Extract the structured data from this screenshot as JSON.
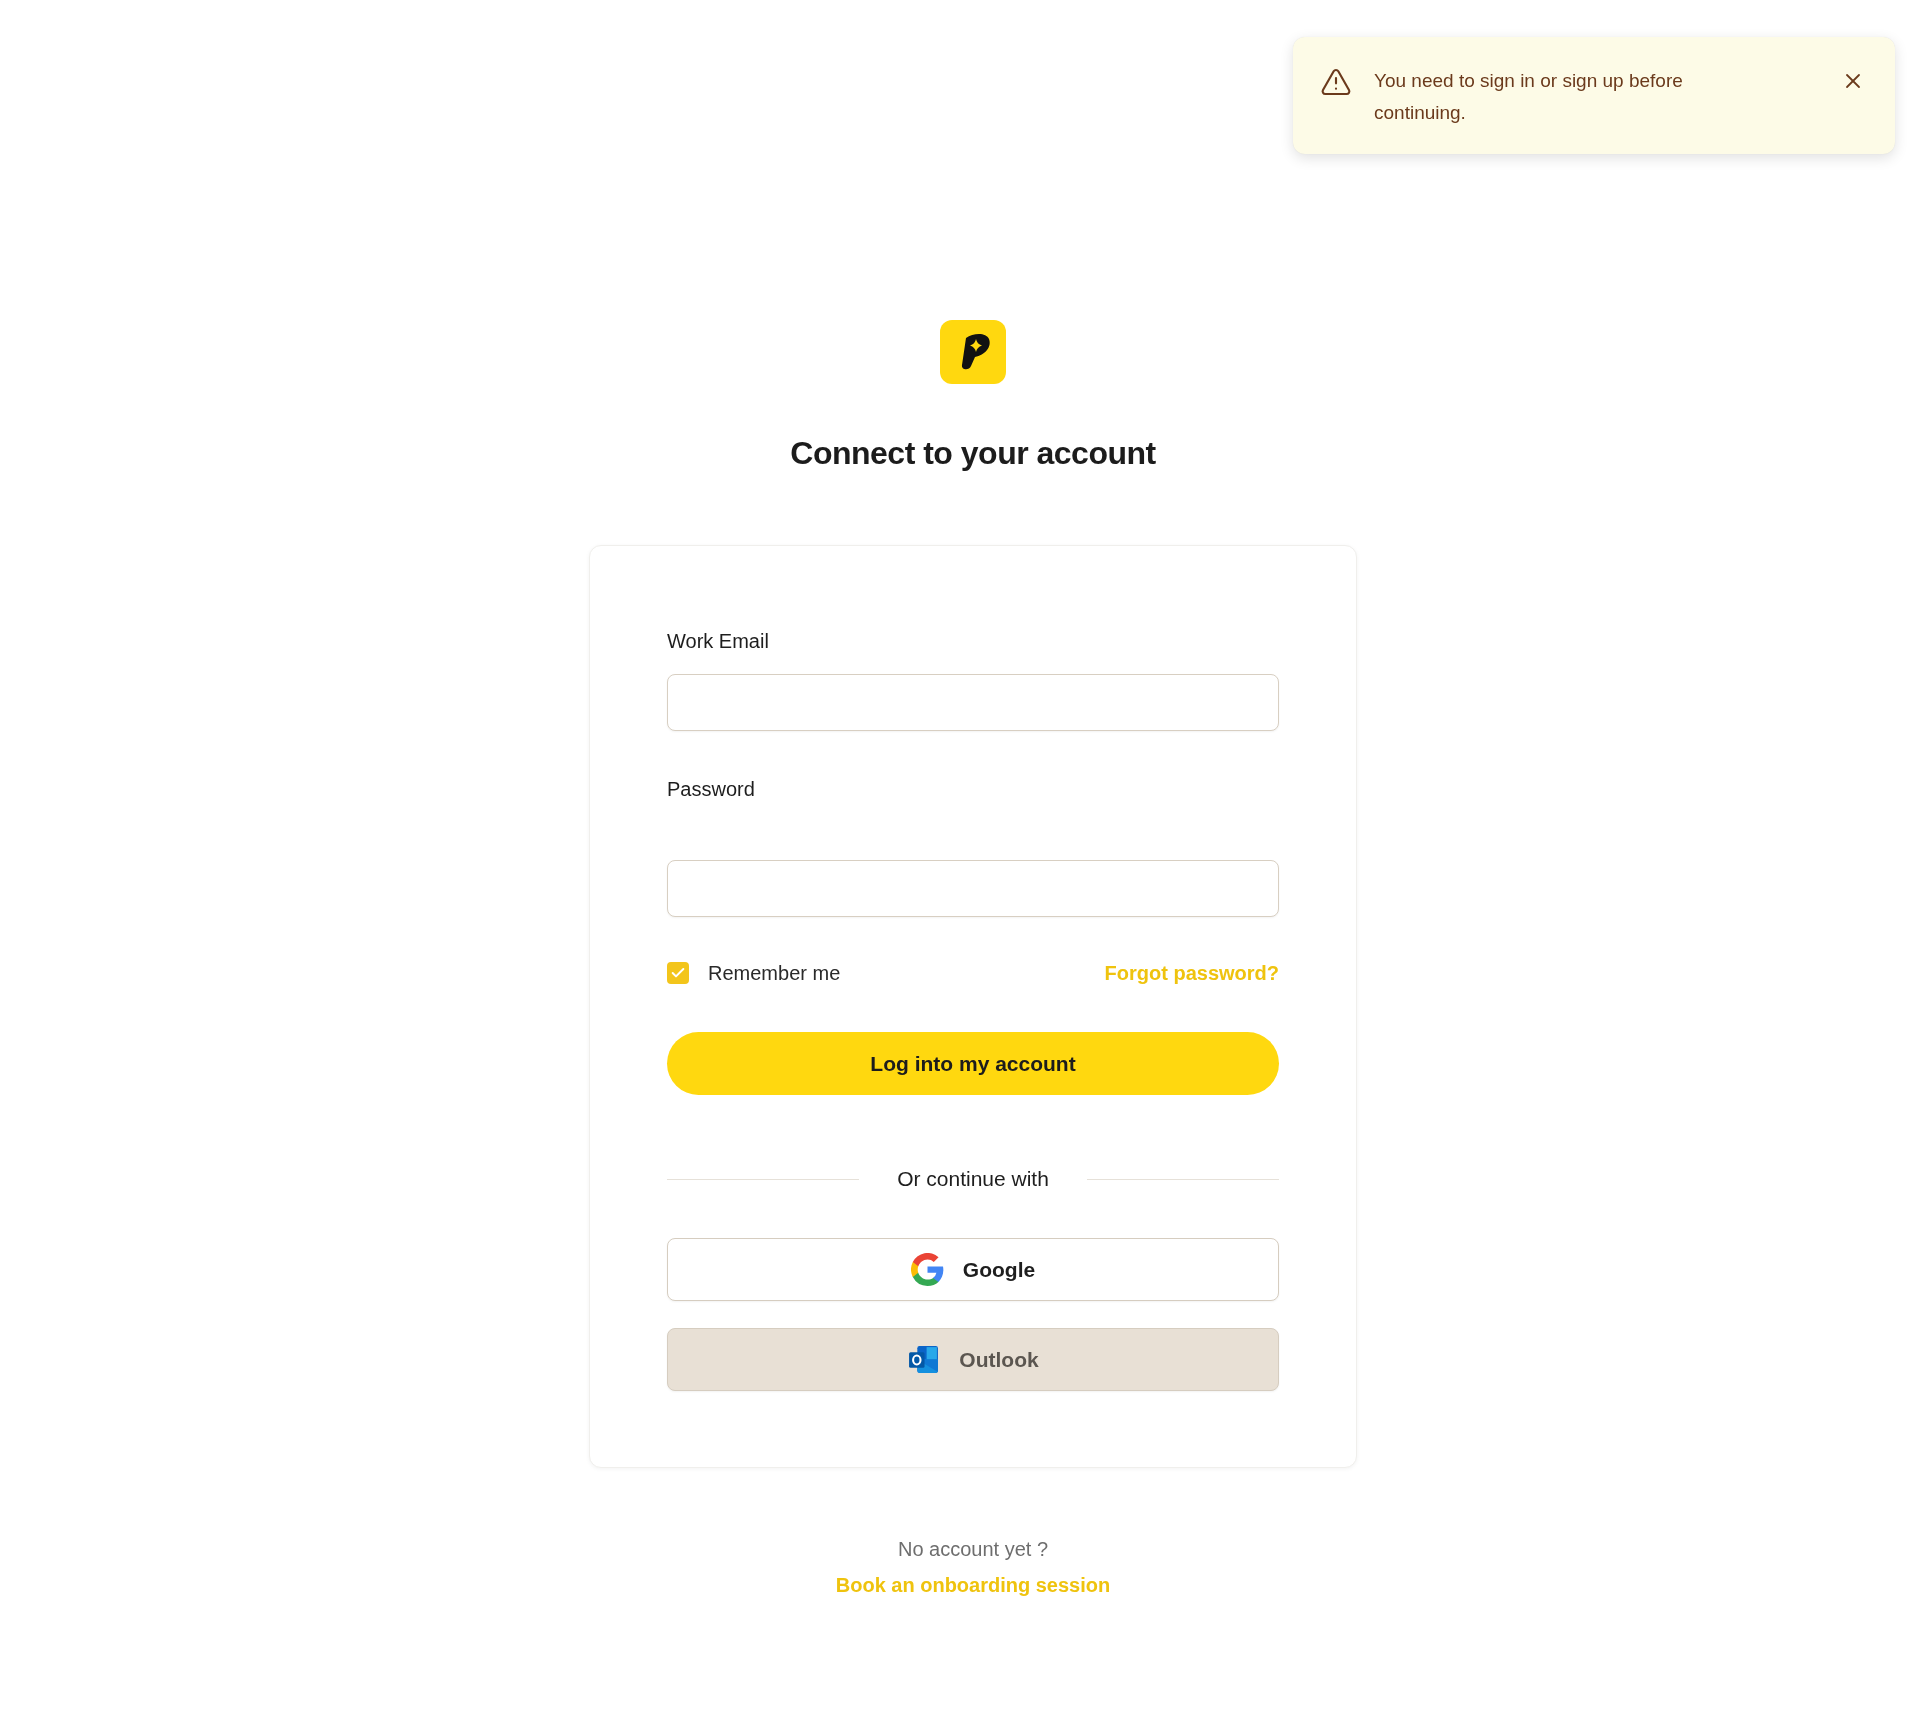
{
  "toast": {
    "message": "You need to sign in or sign up before continuing."
  },
  "title": "Connect to your account",
  "form": {
    "fields": [
      {
        "label": "Work Email"
      },
      {
        "label": "Password"
      }
    ],
    "remember": {
      "label": "Remember me",
      "checked": true
    },
    "forgot_link": "Forgot password?",
    "submit": "Log into my account",
    "divider": "Or continue with",
    "providers": [
      {
        "kind": "google",
        "label": "Google",
        "disabled": false
      },
      {
        "kind": "outlook",
        "label": "Outlook",
        "disabled": true
      }
    ]
  },
  "footer": {
    "prompt": "No account yet ?",
    "link": "Book an onboarding session"
  }
}
